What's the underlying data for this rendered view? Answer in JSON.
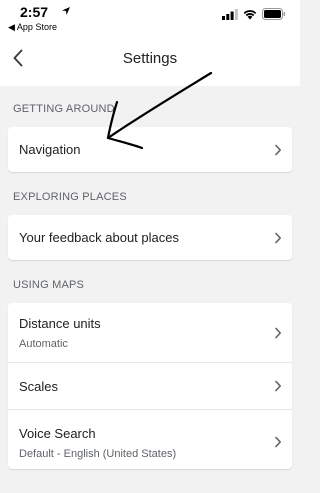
{
  "status_bar": {
    "time": "2:57",
    "back_to_app": "◀ App Store"
  },
  "header": {
    "title": "Settings"
  },
  "sections": [
    {
      "header": "GETTING AROUND",
      "items": [
        {
          "title": "Navigation"
        }
      ]
    },
    {
      "header": "EXPLORING PLACES",
      "items": [
        {
          "title": "Your feedback about places"
        }
      ]
    },
    {
      "header": "USING MAPS",
      "items": [
        {
          "title": "Distance units",
          "subtitle": "Automatic"
        },
        {
          "title": "Scales"
        },
        {
          "title": "Voice Search",
          "subtitle": "Default - English (United States)"
        }
      ]
    }
  ],
  "colors": {
    "background": "#f2f2f2",
    "card": "#ffffff",
    "annotation": "#000000"
  }
}
